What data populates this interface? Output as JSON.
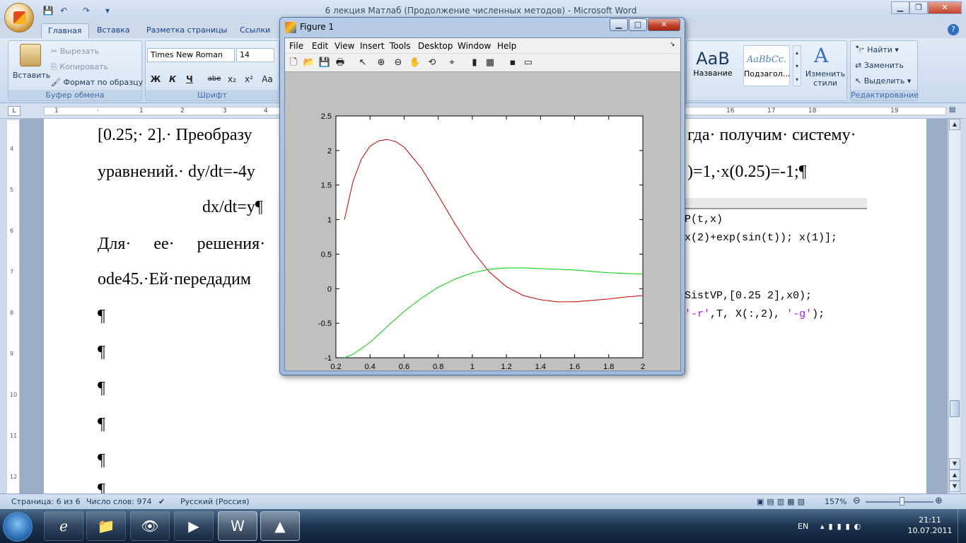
{
  "word": {
    "title": "6 лекция Матлаб (Продолжение численных методов) - Microsoft Word",
    "tabs": [
      "Главная",
      "Вставка",
      "Разметка страницы",
      "Ссылки"
    ],
    "clipboard": {
      "paste": "Вставить",
      "cut": "Вырезать",
      "copy": "Копировать",
      "format_painter": "Формат по образцу",
      "group_label": "Буфер обмена"
    },
    "font": {
      "name": "Times New Roman",
      "size": "14",
      "group_label": "Шрифт",
      "bold": "Ж",
      "italic": "К",
      "underline": "Ч",
      "strike": "abe",
      "subscript": "x₂",
      "superscript": "x²",
      "case": "Aa"
    },
    "styles": {
      "style1_sample": "AaB",
      "style1_name": "Название",
      "style2_sample": "AaBbCc.",
      "style2_name": "Подзагол...",
      "change_styles": "Изменить стили"
    },
    "editing": {
      "find": "Найти",
      "replace": "Заменить",
      "select": "Выделить",
      "group_label": "Редактирование"
    },
    "document": {
      "line1_left": "[0.25;· 2].· Преобразу",
      "line1_right": "гда· получим· систему·",
      "line2_left": "уравнений.· dy/dt=-4y",
      "line2_right": ")=1,·x(0.25)=-1;¶",
      "line3": "dx/dt=y¶",
      "line4": "Для· ее· решения·",
      "line5": "ode45.·Ей·передадим",
      "para_marks": [
        "¶",
        "¶",
        "¶",
        "¶",
        "¶",
        "¶"
      ],
      "code1": "P(t,x)",
      "code2": "x(2)+exp(sin(t)); x(1)];",
      "code3": "SistVP,[0.25 2],x0);",
      "code4_a": "'-r'",
      "code4_b": ",T, X(:,2),",
      "code4_c": "'-g'",
      "code4_d": ");"
    },
    "statusbar": {
      "page": "Страница: 6 из 6",
      "words": "Число слов: 974",
      "language": "Русский (Россия)",
      "zoom": "157%"
    }
  },
  "figure": {
    "title": "Figure 1",
    "menu": [
      "File",
      "Edit",
      "View",
      "Insert",
      "Tools",
      "Desktop",
      "Window",
      "Help"
    ],
    "min": "▁",
    "max": "□",
    "close": "✕"
  },
  "taskbar": {
    "time": "21:11",
    "date": "10.07.2011",
    "lang": "EN"
  },
  "chart_data": {
    "type": "line",
    "title": "",
    "xlabel": "",
    "ylabel": "",
    "xlim": [
      0.2,
      2
    ],
    "ylim": [
      -1,
      2.5
    ],
    "xticks": [
      "0.2",
      "0.4",
      "0.6",
      "0.8",
      "1",
      "1.2",
      "1.4",
      "1.6",
      "1.8",
      "2"
    ],
    "yticks": [
      "-1",
      "-0.5",
      "0",
      "0.5",
      "1",
      "1.5",
      "2",
      "2.5"
    ],
    "grid": false,
    "series": [
      {
        "color": "#c00000",
        "x": [
          0.25,
          0.3,
          0.35,
          0.4,
          0.45,
          0.5,
          0.55,
          0.6,
          0.7,
          0.8,
          0.9,
          1.0,
          1.1,
          1.2,
          1.3,
          1.4,
          1.5,
          1.6,
          1.7,
          1.8,
          1.9,
          2.0
        ],
        "y": [
          1.0,
          1.55,
          1.88,
          2.06,
          2.14,
          2.16,
          2.13,
          2.05,
          1.75,
          1.35,
          0.93,
          0.55,
          0.24,
          0.03,
          -0.1,
          -0.16,
          -0.19,
          -0.19,
          -0.17,
          -0.15,
          -0.12,
          -0.1
        ]
      },
      {
        "color": "#00cc00",
        "x": [
          0.25,
          0.3,
          0.4,
          0.5,
          0.6,
          0.7,
          0.8,
          0.9,
          1.0,
          1.1,
          1.2,
          1.3,
          1.4,
          1.5,
          1.6,
          1.7,
          1.8,
          1.9,
          2.0
        ],
        "y": [
          -1.0,
          -0.95,
          -0.78,
          -0.55,
          -0.33,
          -0.14,
          0.02,
          0.14,
          0.23,
          0.28,
          0.3,
          0.3,
          0.29,
          0.28,
          0.27,
          0.25,
          0.23,
          0.22,
          0.21
        ]
      }
    ]
  }
}
